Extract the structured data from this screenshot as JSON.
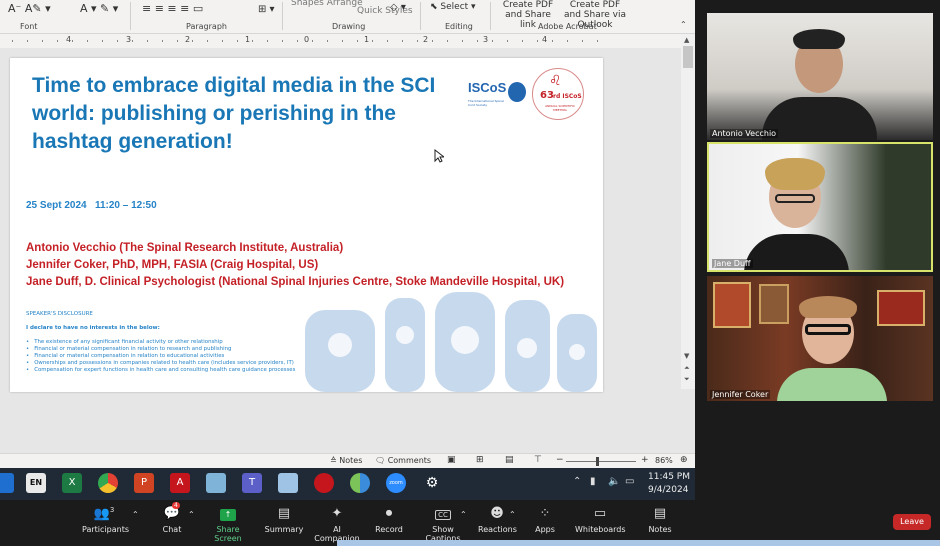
{
  "ribbon": {
    "groups": [
      "Font",
      "Paragraph",
      "Drawing",
      "Editing",
      "Adobe Acrobat"
    ],
    "drawing_items": [
      "Shapes Arrange",
      "Quick Styles"
    ],
    "select_label": "Select",
    "acrobat_items": [
      "Create PDF and Share link",
      "Create PDF and Share via Outlook"
    ]
  },
  "ruler": {
    "marks": [
      "4",
      "3",
      "2",
      "1",
      "0",
      "1",
      "2",
      "3",
      "4"
    ]
  },
  "slide": {
    "title": "Time to embrace digital media in the SCI world: publishing or perishing in the hashtag generation!",
    "date": "25 Sept 2024",
    "time": "11:20 – 12:50",
    "authors": [
      "Antonio Vecchio (The Spinal Research Institute, Australia)",
      "Jennifer Coker, PhD, MPH, FASIA (Craig Hospital, US)",
      "Jane Duff, D. Clinical Psychologist (National Spinal Injuries Centre, Stoke Mandeville Hospital, UK)"
    ],
    "disclosure_heading": "SPEAKER'S DISCLOSURE",
    "disclosure_statement": "I declare to have no interests in the below:",
    "disclosure_items": [
      "The existence of any significant financial activity or other relationship",
      "Financial or material compensation  in relation to research and publishing",
      "Financial or material compensation  in relation to educational activities",
      "Ownerships and possessions in companies related to health care (includes service providers, IT)",
      "Compensation for expert functions in health care and consulting health care guidance processes"
    ],
    "logo_iscos": "ISCoS",
    "logo_iscos_sub": "The International Spinal Cord Society",
    "seal_number": "63",
    "seal_suffix": "rd ISCoS",
    "seal_text": "ANNUAL SCIENTIFIC MEETING"
  },
  "statusbar": {
    "notes": "Notes",
    "comments": "Comments",
    "zoom": "86%"
  },
  "taskbar": {
    "language": "EN",
    "time": "11:45 PM",
    "date": "9/4/2024"
  },
  "participants_panel": [
    {
      "name": "Antonio Vecchio"
    },
    {
      "name": "Jane Duff"
    },
    {
      "name": "Jennifer Coker"
    }
  ],
  "zoom_toolbar": {
    "participants": "Participants",
    "participants_count": "3",
    "chat": "Chat",
    "chat_badge": "4",
    "share_screen": "Share Screen",
    "summary": "Summary",
    "ai_companion": "AI Companion",
    "record": "Record",
    "show_captions": "Show Captions",
    "reactions": "Reactions",
    "apps": "Apps",
    "whiteboards": "Whiteboards",
    "notes": "Notes",
    "leave": "Leave"
  },
  "colors": {
    "title_blue": "#1a77b6",
    "author_red": "#c42127",
    "active_speaker_border": "#d8e36b",
    "share_green": "#1fa34a",
    "leave_red": "#c62828"
  }
}
